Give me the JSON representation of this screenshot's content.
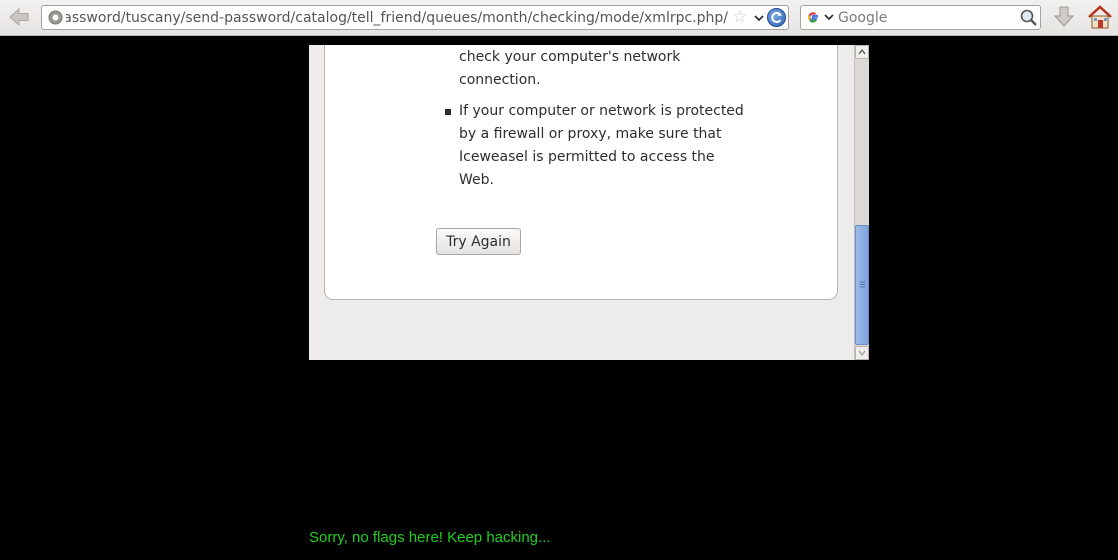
{
  "toolbar": {
    "url": "/forgotpassword/tuscany/send-password/catalog/tell_friend/queues/month/checking/mode/xmlrpc.php",
    "search_placeholder": "Google",
    "icons": [
      "back-arrow-icon",
      "globe-icon",
      "bookmark-star-icon",
      "dropdown-icon",
      "reload-icon",
      "google-icon",
      "search-icon",
      "download-icon",
      "home-icon"
    ]
  },
  "error_page": {
    "lines": [
      "check your computer's network",
      "connection.",
      "If your computer or network is protected",
      "by a firewall or proxy, make sure that",
      "Iceweasel is permitted to access the",
      "Web."
    ],
    "try_again_label": "Try Again"
  },
  "footer": {
    "message": "Sorry, no flags here! Keep hacking...",
    "message_color": "#1fcf1f"
  },
  "colors": {
    "background": "#000000",
    "scroll_thumb": "#8aaee2"
  }
}
